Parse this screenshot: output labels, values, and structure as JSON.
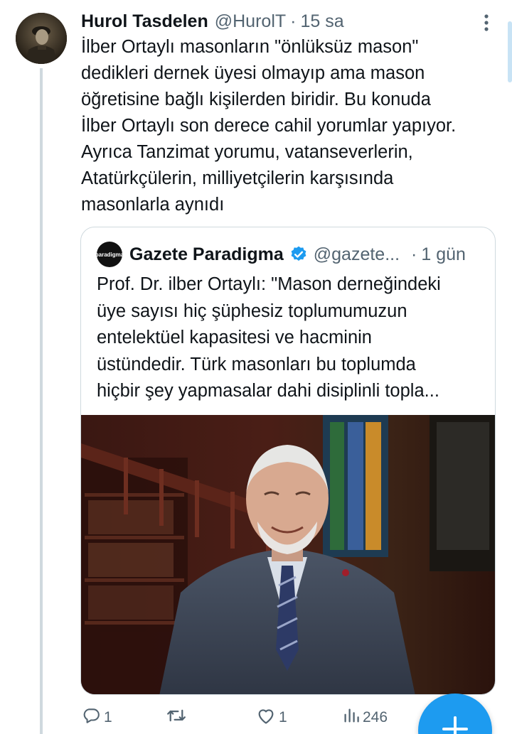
{
  "tweet": {
    "author_name": "Hurol Tasdelen",
    "author_handle": "@HurolT",
    "separator": "·",
    "time": "15 sa",
    "text": "İlber Ortaylı masonların \"önlüksüz mason\"\ndedikleri dernek üyesi olmayıp ama mason\nöğretisine bağlı kişilerden biridir. Bu konuda\nİlber Ortaylı son derece cahil yorumlar yapıyor.\nAyrıca Tanzimat yorumu, vatanseverlerin,\nAtatürkçülerin, milliyetçilerin karşısında\nmasonlarla aynıdı",
    "avatar_icon": "avatar-photo-soldier"
  },
  "quote": {
    "avatar_label": "paradigma",
    "author_name": "Gazete Paradigma",
    "verified_icon": "verified-badge-icon",
    "author_handle": "@gazete...",
    "separator": "·",
    "time": "1 gün",
    "text": "Prof. Dr. ilber Ortaylı: \"Mason derneğindeki\nüye sayısı hiç şüphesiz toplumumuzun\nentelektüel kapasitesi ve hacminin\nüstündedir. Türk masonları bu toplumda\nhiçbir şey yapmasalar dahi disiplinli topla...",
    "image_icon": "photo-elderly-man-in-library"
  },
  "actions": {
    "reply_count": "1",
    "retweet_count": "",
    "like_count": "1",
    "views_count": "246"
  },
  "fab_icon": "plus-icon",
  "colors": {
    "accent": "#1d9bf0",
    "text": "#0f1419",
    "secondary": "#536471",
    "border": "#cfd9de"
  }
}
